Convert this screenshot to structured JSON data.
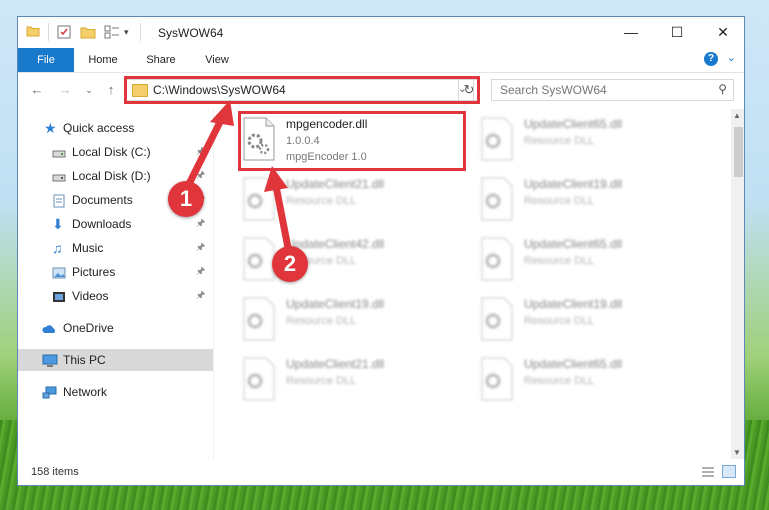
{
  "window": {
    "title": "SysWOW64"
  },
  "ribbon": {
    "tabs": [
      "File",
      "Home",
      "Share",
      "View"
    ]
  },
  "address": {
    "path": "C:\\Windows\\SysWOW64"
  },
  "search": {
    "placeholder": "Search SysWOW64"
  },
  "sidebar": {
    "items": [
      {
        "label": "Quick access",
        "icon": "star-icon"
      },
      {
        "label": "Local Disk (C:)",
        "icon": "drive-icon"
      },
      {
        "label": "Local Disk (D:)",
        "icon": "drive-icon"
      },
      {
        "label": "Documents",
        "icon": "documents-icon"
      },
      {
        "label": "Downloads",
        "icon": "download-icon"
      },
      {
        "label": "Music",
        "icon": "music-icon"
      },
      {
        "label": "Pictures",
        "icon": "pictures-icon"
      },
      {
        "label": "Videos",
        "icon": "videos-icon"
      },
      {
        "label": "OneDrive",
        "icon": "cloud-icon"
      },
      {
        "label": "This PC",
        "icon": "computer-icon"
      },
      {
        "label": "Network",
        "icon": "network-icon"
      }
    ]
  },
  "files": [
    {
      "name": "mpgencoder.dll",
      "version": "1.0.0.4",
      "description": "mpgEncoder 1.0"
    },
    {
      "name": "UpdateClient65.dll",
      "description": "Resource DLL"
    },
    {
      "name": "UpdateClient21.dll",
      "description": "Resource DLL"
    },
    {
      "name": "UpdateClient19.dll",
      "description": "Resource DLL"
    },
    {
      "name": "UpdateClient42.dll",
      "description": "Resource DLL"
    },
    {
      "name": "UpdateClient65.dll",
      "description": "Resource DLL"
    },
    {
      "name": "UpdateClient19.dll",
      "description": "Resource DLL"
    },
    {
      "name": "UpdateClient19.dll",
      "description": "Resource DLL"
    },
    {
      "name": "UpdateClient21.dll",
      "description": "Resource DLL"
    },
    {
      "name": "UpdateClient65.dll",
      "description": "Resource DLL"
    }
  ],
  "status": {
    "item_count": "158 items"
  },
  "markers": [
    "1",
    "2"
  ],
  "colors": {
    "accent": "#1979ca",
    "highlight": "#e0353a"
  }
}
